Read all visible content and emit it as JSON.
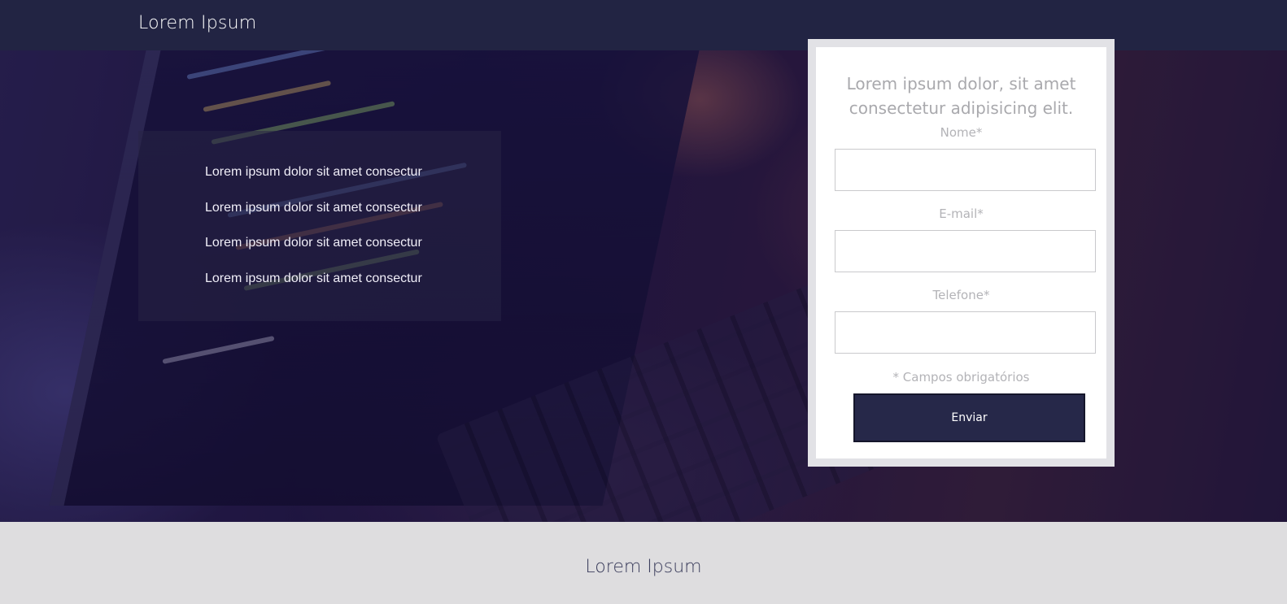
{
  "header": {
    "brand": "Lorem Ipsum"
  },
  "hero": {
    "features": [
      "Lorem ipsum dolor sit amet consectur",
      "Lorem ipsum dolor sit amet consectur",
      "Lorem ipsum dolor sit amet consectur",
      "Lorem ipsum dolor sit amet consectur"
    ]
  },
  "form": {
    "title": "Lorem ipsum dolor, sit amet consectetur adipisicing elit.",
    "fields": [
      {
        "label": "Nome*",
        "value": ""
      },
      {
        "label": "E-mail*",
        "value": ""
      },
      {
        "label": "Telefone*",
        "value": ""
      }
    ],
    "required_note": "* Campos obrigatórios",
    "submit_label": "Enviar"
  },
  "footer": {
    "title": "Lorem Ipsum"
  },
  "colors": {
    "nav": "#222443",
    "button": "#262849",
    "footer": "#dedddf",
    "muted_text": "#b3b3b7"
  }
}
